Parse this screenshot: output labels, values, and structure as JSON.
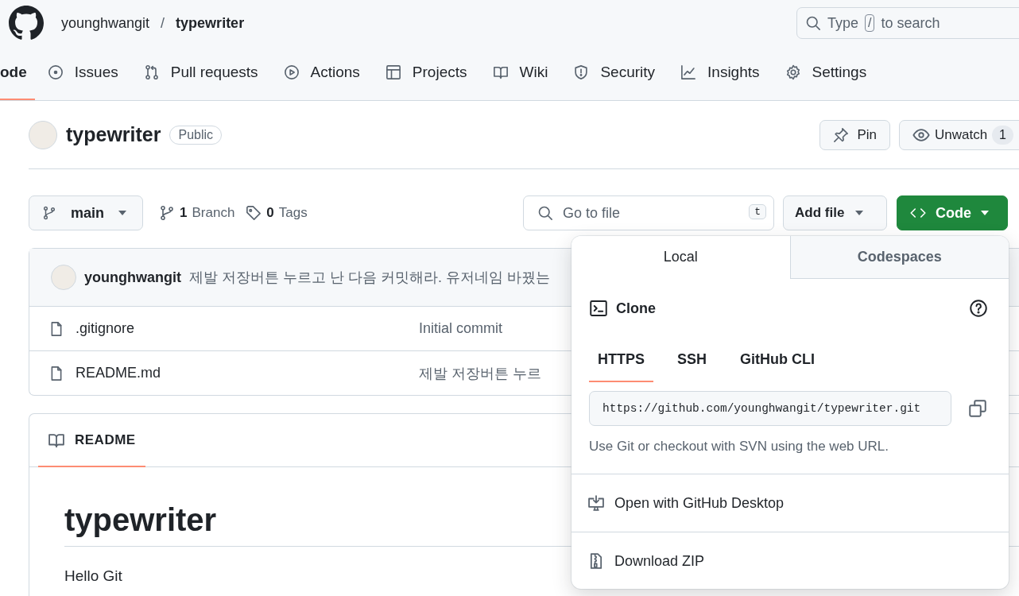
{
  "header": {
    "owner": "younghwangit",
    "separator": "/",
    "repo": "typewriter",
    "search": {
      "before": "Type",
      "key": "/",
      "after": "to search"
    }
  },
  "nav": [
    {
      "kind": "code",
      "label": "ode",
      "selected": true
    },
    {
      "kind": "issues",
      "label": "Issues",
      "selected": false
    },
    {
      "kind": "pulls",
      "label": "Pull requests",
      "selected": false
    },
    {
      "kind": "actions",
      "label": "Actions",
      "selected": false
    },
    {
      "kind": "projects",
      "label": "Projects",
      "selected": false
    },
    {
      "kind": "wiki",
      "label": "Wiki",
      "selected": false
    },
    {
      "kind": "security",
      "label": "Security",
      "selected": false
    },
    {
      "kind": "insights",
      "label": "Insights",
      "selected": false
    },
    {
      "kind": "settings",
      "label": "Settings",
      "selected": false
    }
  ],
  "repo": {
    "name": "typewriter",
    "visibility": "Public",
    "pin": "Pin",
    "watch": "Unwatch",
    "watch_count": "1"
  },
  "toolbar": {
    "branch": "main",
    "branch_count": "1",
    "branch_label": "Branch",
    "tag_count": "0",
    "tag_label": "Tags",
    "file_search": {
      "placeholder": "Go to file",
      "key": "t"
    },
    "add_file": "Add file",
    "code": "Code"
  },
  "files": {
    "commit": {
      "author": "younghwangit",
      "message": "제발 저장버튼 누르고 난 다음 커밋해라. 유저네임 바꿨는"
    },
    "rows": [
      {
        "name": ".gitignore",
        "message": "Initial commit"
      },
      {
        "name": "README.md",
        "message": "제발 저장버튼 누르"
      }
    ]
  },
  "readme": {
    "tab": "README",
    "heading": "typewriter",
    "body": "Hello Git"
  },
  "clone_menu": {
    "tabs": [
      {
        "label": "Local",
        "selected": true
      },
      {
        "label": "Codespaces",
        "selected": false
      }
    ],
    "title": "Clone",
    "protocols": [
      {
        "label": "HTTPS",
        "selected": true
      },
      {
        "label": "SSH",
        "selected": false
      },
      {
        "label": "GitHub CLI",
        "selected": false
      }
    ],
    "url": "https://github.com/younghwangit/typewriter.git",
    "hint": "Use Git or checkout with SVN using the web URL.",
    "actions": [
      {
        "kind": "desktop",
        "label": "Open with GitHub Desktop"
      },
      {
        "kind": "zip",
        "label": "Download ZIP"
      }
    ]
  }
}
